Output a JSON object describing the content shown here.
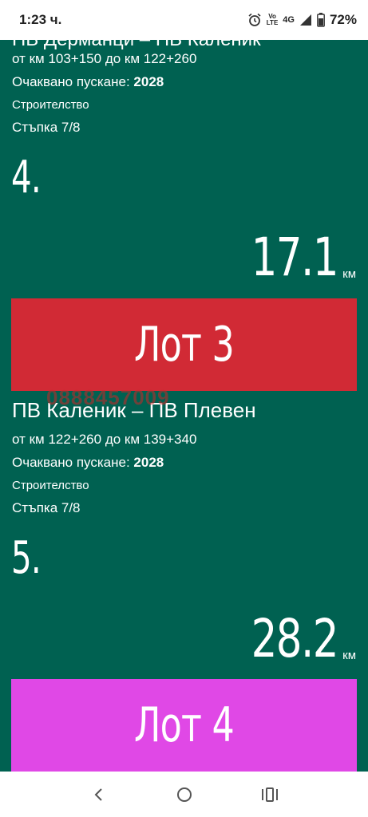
{
  "status_bar": {
    "time": "1:23 ч.",
    "volte_top": "Vo",
    "volte_bottom": "LTE",
    "network": "4G",
    "battery": "72%"
  },
  "sections": [
    {
      "title_cut": "ПВ Дерманци – ПВ Каленик",
      "range": "от км 103+150 до км 122+260",
      "expected_label": "Очаквано пускане: ",
      "expected_year": "2028",
      "stage": "Строителство",
      "step": "Стъпка 7/8",
      "number": "4.",
      "km_value": "17.1",
      "km_unit": "км"
    },
    {
      "title": "ПВ Каленик – ПВ Плевен",
      "range": "от км 122+260 до км 139+340",
      "expected_label": "Очаквано пускане: ",
      "expected_year": "2028",
      "stage": "Строителство",
      "step": "Стъпка 7/8",
      "number": "5.",
      "km_value": "28.2",
      "km_unit": "км"
    }
  ],
  "lots": [
    {
      "label": "Лот 3",
      "color": "#d12a35"
    },
    {
      "label": "Лот 4",
      "color": "#e048e6"
    }
  ],
  "watermark": "0888457009",
  "colors": {
    "background": "#006151",
    "text": "#ffffff"
  }
}
